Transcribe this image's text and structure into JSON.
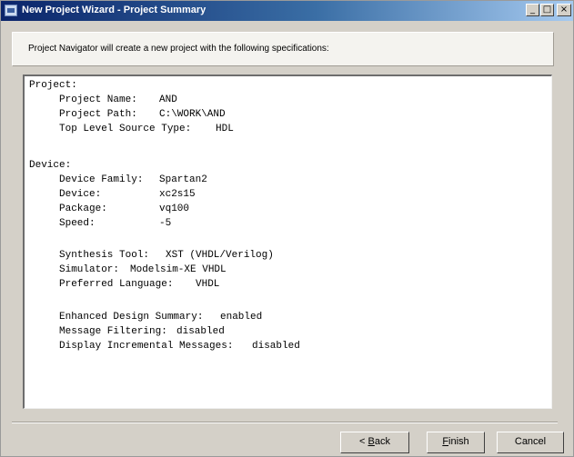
{
  "window": {
    "title": "New Project Wizard - Project Summary",
    "title_buttons": {
      "minimize": "_",
      "maximize": "□",
      "close": "×"
    }
  },
  "info": "Project Navigator will create a new project with the following specifications:",
  "summary": {
    "project_heading": "Project:",
    "project": [
      {
        "label": "Project Name:",
        "value": "AND"
      },
      {
        "label": "Project Path:",
        "value": "C:\\WORK\\AND"
      },
      {
        "label": "Top Level Source Type:",
        "value": "HDL"
      }
    ],
    "device_heading": "Device:",
    "device_family": {
      "label": "Device Family:",
      "value": "Spartan2"
    },
    "device_specs": [
      {
        "label": "Device:",
        "value": "xc2s15"
      },
      {
        "label": "Package:",
        "value": "vq100"
      },
      {
        "label": "Speed:",
        "value": "-5"
      }
    ],
    "tools": [
      {
        "label": "Synthesis Tool:",
        "value": "XST (VHDL/Verilog)"
      },
      {
        "label": "Simulator:",
        "value": "Modelsim-XE VHDL"
      },
      {
        "label": "Preferred Language:",
        "value": "VHDL"
      }
    ],
    "options": [
      {
        "label": "Enhanced Design Summary:",
        "value": "enabled"
      },
      {
        "label": "Message Filtering:",
        "value": "disabled"
      },
      {
        "label": "Display Incremental Messages:",
        "value": "disabled"
      }
    ]
  },
  "buttons": {
    "back": {
      "prefix": "< ",
      "accel": "B",
      "rest": "ack"
    },
    "finish": {
      "accel": "F",
      "rest": "inish"
    },
    "cancel": "Cancel"
  }
}
